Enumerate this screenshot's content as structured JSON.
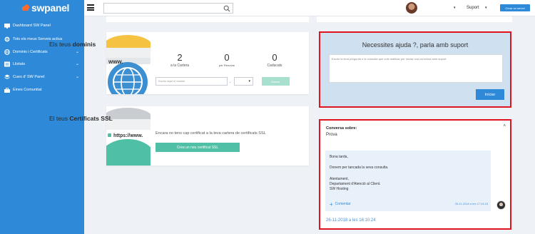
{
  "brand": {
    "name": "swpanel"
  },
  "sidebar": {
    "items": [
      {
        "label": "Dashboard SW Panel",
        "icon": "dashboard-icon",
        "chevron": false
      },
      {
        "label": "Tots els meus Serveis actius",
        "icon": "gear-icon",
        "chevron": false
      },
      {
        "label": "Dominis i Certificats",
        "icon": "globe-icon",
        "chevron": true
      },
      {
        "label": "Llistats",
        "icon": "list-icon",
        "chevron": true
      },
      {
        "label": "Cues d' SW Panel",
        "icon": "layers-icon",
        "chevron": true
      },
      {
        "label": "Eines Comunitat",
        "icon": "toolbox-icon",
        "chevron": false
      }
    ]
  },
  "topbar": {
    "search_placeholder": "",
    "dropdown_caret": "▾",
    "support_label": "Suport",
    "support_caret": "▾",
    "create_button": "Crear un servei"
  },
  "domains": {
    "title_prefix": "Els teus ",
    "title_bold": "dominis",
    "illus_text": "www.",
    "stats": [
      {
        "value": "2",
        "label": "a la Cartera"
      },
      {
        "value": "0",
        "label": "per Renovar"
      },
      {
        "value": "0",
        "label": "Caducats"
      }
    ],
    "input_placeholder": "Escriu aquí el domini",
    "dot": ".",
    "tld_caret": "▾",
    "search_button": "Buscar"
  },
  "ssl": {
    "title_prefix": "El teus ",
    "title_bold": "Certificats SSL",
    "illus_text": "https://www.",
    "text": "Encara no tens cap certificat a la teva cartera de certificats SSL",
    "button": "Crea un nou certificat SSL"
  },
  "help": {
    "title": "Necessites ajuda ?, parla amb suport",
    "placeholder": "Escriu la teva pregunta o la consulta que vols realitzar per iniciar una conversa amb suport",
    "button": "Iniciar"
  },
  "conversation": {
    "heading": "Conversa sobre:",
    "subject": "Prova",
    "collapse": "˄",
    "message_lines": [
      "Bona tarda,",
      "Donem per tancada la seva consulta.",
      "Atentament,",
      "Departament d'Atenció al Client.",
      "SW Hosting"
    ],
    "comment_label": "Comentar",
    "message_meta": "26-11-2018 a les 17:24:18",
    "date": "26-11-2018 a les 16:10:24"
  },
  "colors": {
    "sidebar": "#2e8ad8",
    "accent_green": "#4fc0a5",
    "highlight_red": "#e0141e",
    "help_bg": "#cfe0f1"
  }
}
